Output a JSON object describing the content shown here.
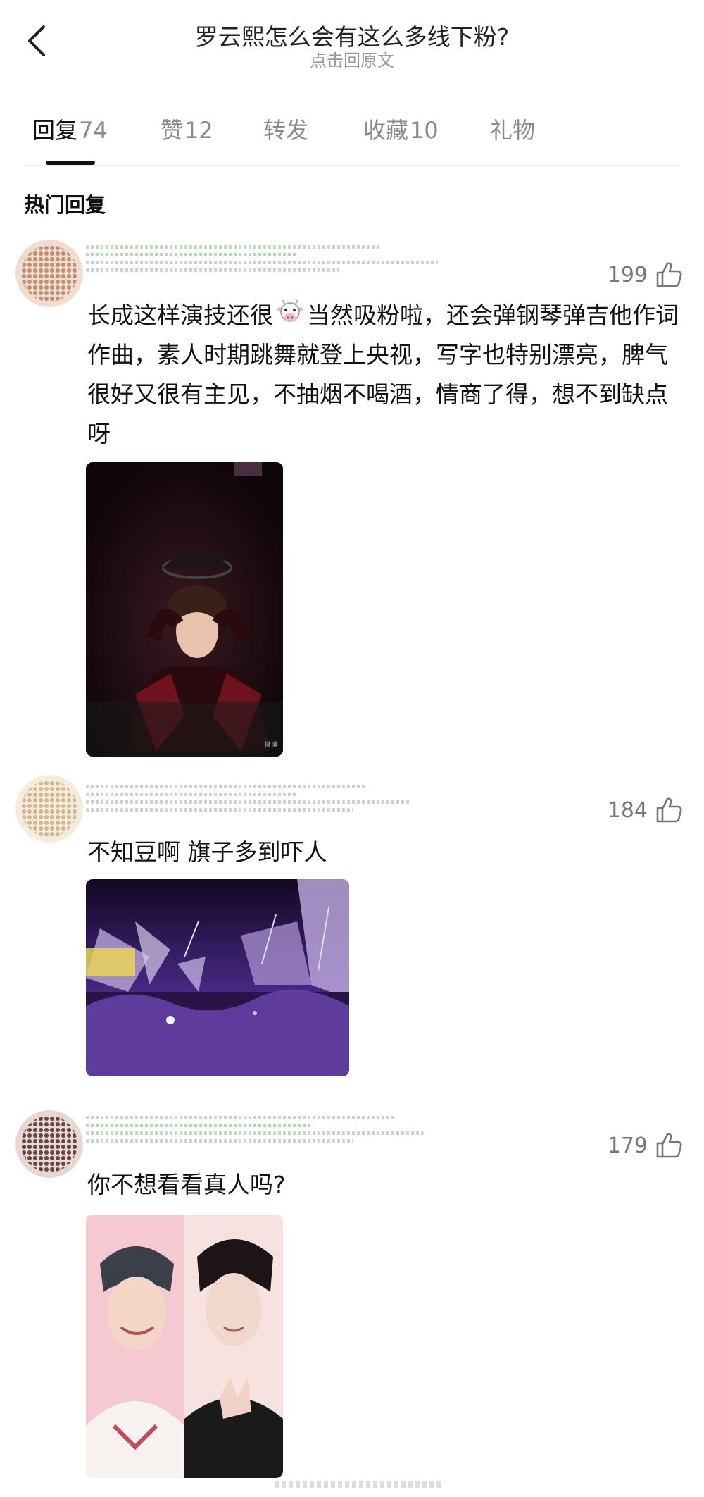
{
  "header": {
    "title": "罗云熙怎么会有这么多线下粉?",
    "subtitle": "点击回原文"
  },
  "tabs": [
    {
      "label": "回复",
      "count": "74"
    },
    {
      "label": "赞",
      "count": "12"
    },
    {
      "label": "转发",
      "count": ""
    },
    {
      "label": "收藏",
      "count": "10"
    },
    {
      "label": "礼物",
      "count": ""
    }
  ],
  "section_label": "热门回复",
  "comments": [
    {
      "likes": "199",
      "text_parts": [
        "长成这样演技还很",
        "当然吸粉啦，还会弹钢琴弹吉他作词作曲，素人时期跳舞就登上央视，写字也特别漂亮，脾气很好又很有主见，不抽烟不喝酒，情商了得，想不到缺点呀"
      ],
      "emoji": "cow-face-emoji",
      "image_watermark": "微博"
    },
    {
      "likes": "184",
      "text": "不知豆啊 旗子多到吓人"
    },
    {
      "likes": "179",
      "text": "你不想看看真人吗?"
    }
  ],
  "icons": {
    "back": "chevron-left-icon",
    "like": "thumbs-up-icon"
  },
  "colors": {
    "active_tab": "#111111",
    "inactive_tab": "#8a8a8a",
    "like_count": "#777777",
    "concert_purple": "#7c3fc4"
  }
}
